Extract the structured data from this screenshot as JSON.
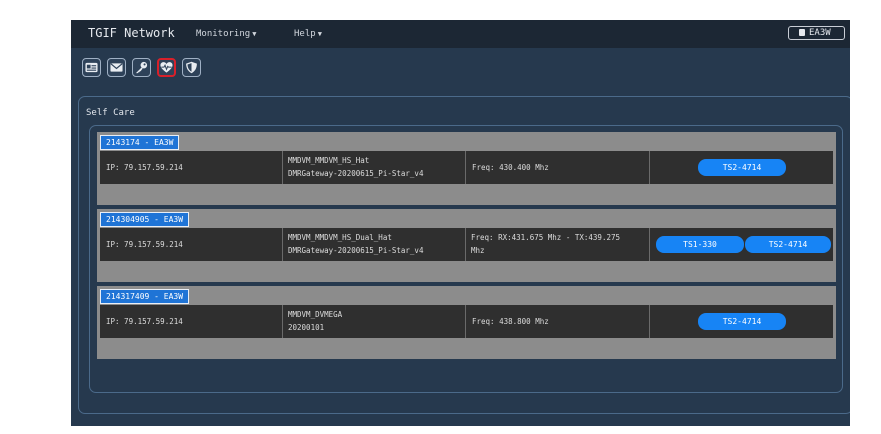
{
  "navbar": {
    "brand": "TGIF Network",
    "menu": [
      {
        "label": "Monitoring"
      },
      {
        "label": "Help"
      }
    ],
    "user_button": "EA3W"
  },
  "toolbar": {
    "icons": [
      "id-card-icon",
      "envelope-icon",
      "key-icon",
      "heartbeat-icon",
      "shield-icon"
    ],
    "active_icon": "heartbeat-icon",
    "active_outline_color": "#d8202a"
  },
  "panel": {
    "title": "Self Care",
    "cards": [
      {
        "title": "2143174 - EA3W",
        "ip": "IP: 79.157.59.214",
        "hardware": [
          "MMDVM_MMDVM_HS_Hat",
          "DMRGateway-20200615_Pi-Star_v4"
        ],
        "freq": [
          "Freq: 430.400 Mhz"
        ],
        "timeslots": [
          "TS2-4714"
        ]
      },
      {
        "title": "214304905 - EA3W",
        "ip": "IP: 79.157.59.214",
        "hardware": [
          "MMDVM_MMDVM_HS_Dual_Hat",
          "DMRGateway-20200615_Pi-Star_v4"
        ],
        "freq": [
          "Freq: RX:431.675 Mhz - TX:439.275",
          "Mhz"
        ],
        "timeslots": [
          "TS1-330",
          "TS2-4714"
        ]
      },
      {
        "title": "214317409 - EA3W",
        "ip": "IP: 79.157.59.214",
        "hardware": [
          "MMDVM_DVMEGA",
          "20200101"
        ],
        "freq": [
          "Freq: 438.800 Mhz"
        ],
        "timeslots": [
          "TS2-4714"
        ]
      }
    ]
  },
  "colors": {
    "background": "#26394e",
    "navbar": "#1c2734",
    "card": "#8c8c8c",
    "row": "#2f2f2f",
    "title_badge": "#1f74d6",
    "timeslot_button": "#1784f5"
  }
}
